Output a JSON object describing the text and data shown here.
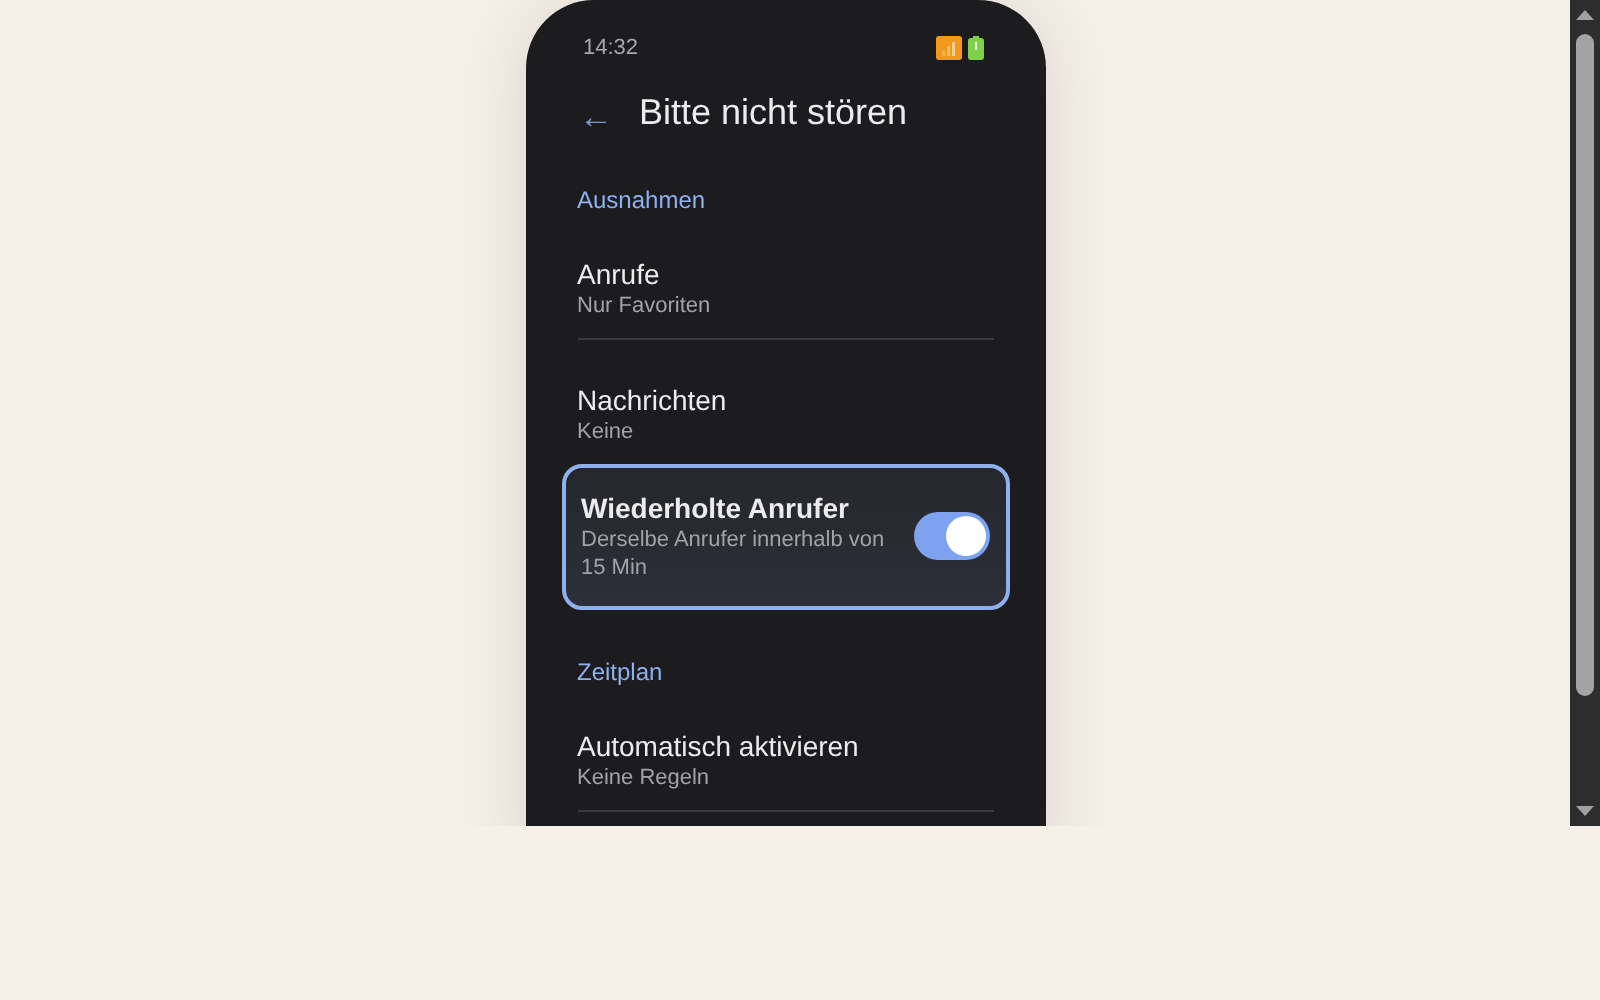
{
  "status_bar": {
    "time": "14:32"
  },
  "header": {
    "back": "←",
    "title": "Bitte nicht stören"
  },
  "sections": [
    {
      "title": "Ausnahmen",
      "items": [
        {
          "kind": "nav",
          "title": "Anrufe",
          "subtitle": "Nur Favoriten",
          "focused": false
        },
        {
          "kind": "nav",
          "title": "Nachrichten",
          "subtitle": "Keine",
          "focused": false
        },
        {
          "kind": "toggle",
          "title": "Wiederholte Anrufer",
          "subtitle": "Derselbe Anrufer innerhalb von 15 Min",
          "on": true,
          "focused": true
        }
      ]
    },
    {
      "title": "Zeitplan",
      "items": [
        {
          "kind": "nav",
          "title": "Automatisch aktivieren",
          "subtitle": "Keine Regeln",
          "focused": false
        }
      ]
    }
  ]
}
